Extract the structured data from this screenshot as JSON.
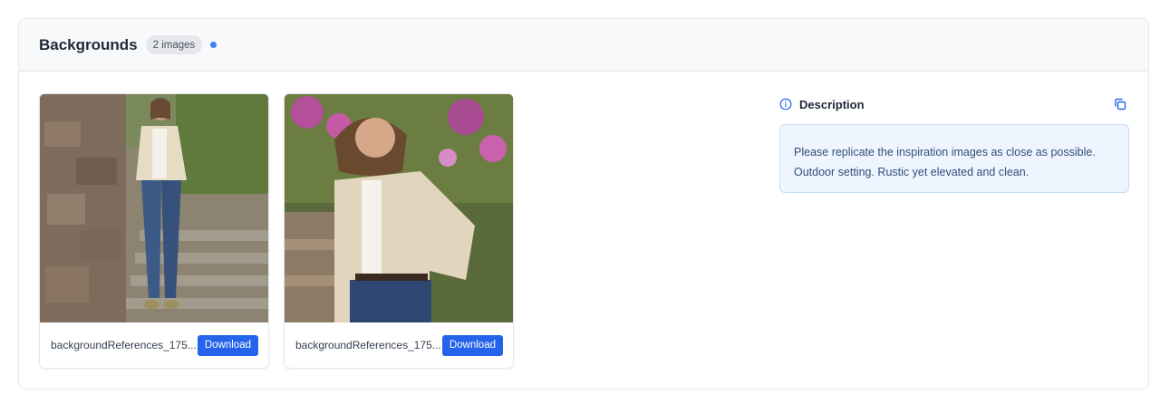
{
  "section": {
    "title": "Backgrounds",
    "count_badge": "2 images",
    "status_dot_color": "#3b82f6"
  },
  "images": [
    {
      "filename": "backgroundReferences_175...",
      "download_label": "Download",
      "thumb_icon": "photo-woman-on-stone-stairs"
    },
    {
      "filename": "backgroundReferences_175...",
      "download_label": "Download",
      "thumb_icon": "photo-woman-in-garden"
    }
  ],
  "description": {
    "title": "Description",
    "icon": "info-icon",
    "copy_icon": "copy-icon",
    "lines": [
      "Please replicate the inspiration images as close as possible.",
      "Outdoor setting. Rustic yet elevated and clean."
    ]
  },
  "colors": {
    "accent": "#2563eb",
    "description_bg": "#eef5ff",
    "description_border": "#c7dcf6"
  }
}
